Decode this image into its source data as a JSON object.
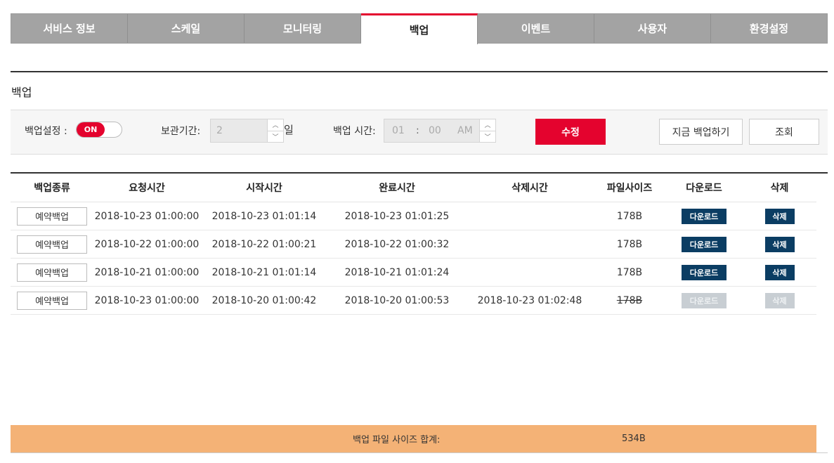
{
  "tabs": [
    {
      "label": "서비스 정보",
      "active": false
    },
    {
      "label": "스케일",
      "active": false
    },
    {
      "label": "모니터링",
      "active": false
    },
    {
      "label": "백업",
      "active": true
    },
    {
      "label": "이벤트",
      "active": false
    },
    {
      "label": "사용자",
      "active": false
    },
    {
      "label": "환경설정",
      "active": false
    }
  ],
  "section_title": "백업",
  "settings": {
    "backup_setting_label": "백업설정 :",
    "toggle_label": "ON",
    "retention_label": "보관기간:",
    "retention_value": "2",
    "retention_unit": "일",
    "backup_time_label": "백업 시간:",
    "hour": "01",
    "colon": ":",
    "minute": "00",
    "ampm": "AM",
    "modify_button": "수정",
    "backup_now_button": "지금 백업하기",
    "query_button": "조회"
  },
  "table": {
    "headers": [
      "백업종류",
      "요청시간",
      "시작시간",
      "완료시간",
      "삭제시간",
      "파일사이즈",
      "다운로드",
      "삭제"
    ],
    "rows": [
      {
        "type": "예약백업",
        "requested": "2018-10-23 01:00:00",
        "started": "2018-10-23 01:01:14",
        "completed": "2018-10-23 01:01:25",
        "deleted": "",
        "size": "178B",
        "download": "다운로드",
        "delete": "삭제"
      },
      {
        "type": "예약백업",
        "requested": "2018-10-22 01:00:00",
        "started": "2018-10-22 01:00:21",
        "completed": "2018-10-22 01:00:32",
        "deleted": "",
        "size": "178B",
        "download": "다운로드",
        "delete": "삭제"
      },
      {
        "type": "예약백업",
        "requested": "2018-10-21 01:00:00",
        "started": "2018-10-21 01:01:14",
        "completed": "2018-10-21 01:01:24",
        "deleted": "",
        "size": "178B",
        "download": "다운로드",
        "delete": "삭제"
      },
      {
        "type": "예약백업",
        "requested": "2018-10-23 01:00:00",
        "started": "2018-10-20 01:00:42",
        "completed": "2018-10-20 01:00:53",
        "deleted": "2018-10-23 01:02:48",
        "size": "178B",
        "download": "다운로드",
        "delete": "삭제"
      }
    ]
  },
  "footer": {
    "total_label": "백업 파일 사이즈 합계:",
    "total_value": "534B"
  },
  "colors": {
    "accent": "#e4032e",
    "navy_button": "#0b3d63",
    "tab_inactive": "#a3a3a3",
    "footer_bar": "#f4b276"
  }
}
